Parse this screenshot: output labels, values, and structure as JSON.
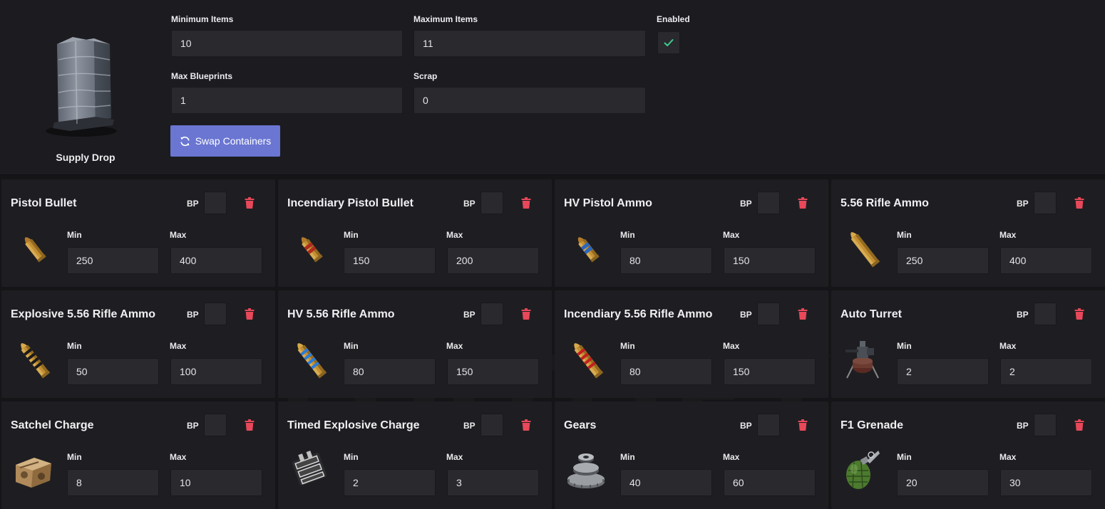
{
  "container": {
    "name": "Supply Drop",
    "min_items_label": "Minimum Items",
    "min_items_value": "10",
    "max_items_label": "Maximum Items",
    "max_items_value": "11",
    "enabled_label": "Enabled",
    "enabled": true,
    "max_blueprints_label": "Max Blueprints",
    "max_blueprints_value": "1",
    "scrap_label": "Scrap",
    "scrap_value": "0",
    "swap_button_label": "Swap Containers"
  },
  "labels": {
    "bp": "BP",
    "min": "Min",
    "max": "Max"
  },
  "colors": {
    "accent": "#6a76d2",
    "check": "#3ecf8e",
    "delete": "#e8485a",
    "panel": "#1e1e22",
    "input": "#29292e"
  },
  "items": [
    {
      "name": "Pistol Bullet",
      "icon": "pistol-bullet-icon",
      "min": "250",
      "max": "400"
    },
    {
      "name": "Incendiary Pistol Bullet",
      "icon": "incendiary-pistol-bullet-icon",
      "min": "150",
      "max": "200"
    },
    {
      "name": "HV Pistol Ammo",
      "icon": "hv-pistol-ammo-icon",
      "min": "80",
      "max": "150"
    },
    {
      "name": "5.56 Rifle Ammo",
      "icon": "rifle-ammo-icon",
      "min": "250",
      "max": "400"
    },
    {
      "name": "Explosive 5.56 Rifle Ammo",
      "icon": "explosive-rifle-ammo-icon",
      "min": "50",
      "max": "100"
    },
    {
      "name": "HV 5.56 Rifle Ammo",
      "icon": "hv-rifle-ammo-icon",
      "min": "80",
      "max": "150"
    },
    {
      "name": "Incendiary 5.56 Rifle Ammo",
      "icon": "incendiary-rifle-ammo-icon",
      "min": "80",
      "max": "150"
    },
    {
      "name": "Auto Turret",
      "icon": "auto-turret-icon",
      "min": "2",
      "max": "2"
    },
    {
      "name": "Satchel Charge",
      "icon": "satchel-charge-icon",
      "min": "8",
      "max": "10"
    },
    {
      "name": "Timed Explosive Charge",
      "icon": "timed-explosive-charge-icon",
      "min": "2",
      "max": "3"
    },
    {
      "name": "Gears",
      "icon": "gears-icon",
      "min": "40",
      "max": "60"
    },
    {
      "name": "F1 Grenade",
      "icon": "f1-grenade-icon",
      "min": "20",
      "max": "30"
    }
  ]
}
